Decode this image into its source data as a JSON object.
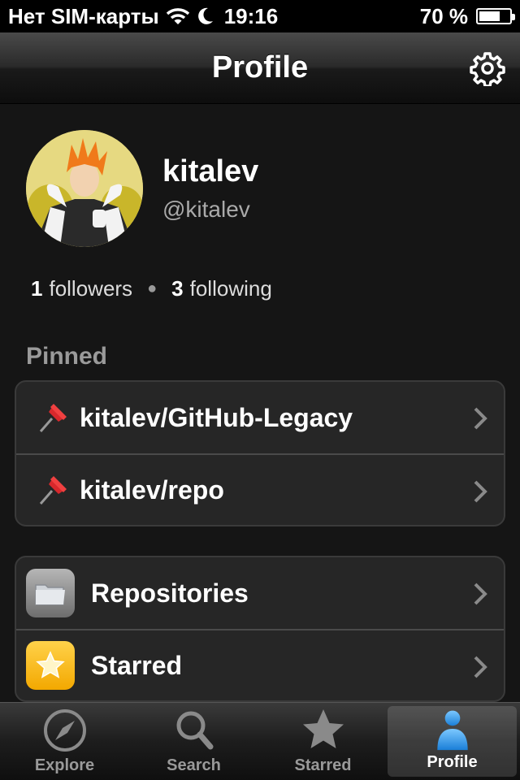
{
  "status_bar": {
    "carrier": "Нет SIM-карты",
    "time": "19:16",
    "battery": "70 %",
    "battery_level": 0.7
  },
  "nav": {
    "title": "Profile",
    "settings_icon": "gear-icon"
  },
  "profile": {
    "name": "kitalev",
    "handle": "@kitalev",
    "followers_count": "1",
    "followers_label": "followers",
    "following_count": "3",
    "following_label": "following",
    "avatar_icon": "avatar"
  },
  "pinned": {
    "label": "Pinned",
    "items": [
      {
        "name": "kitalev/GitHub-Legacy",
        "icon": "pushpin-icon"
      },
      {
        "name": "kitalev/repo",
        "icon": "pushpin-icon"
      }
    ]
  },
  "menu": {
    "items": [
      {
        "label": "Repositories",
        "icon": "folder-icon"
      },
      {
        "label": "Starred",
        "icon": "star-icon"
      }
    ]
  },
  "tabs": [
    {
      "label": "Explore",
      "icon": "compass-icon",
      "active": false
    },
    {
      "label": "Search",
      "icon": "search-icon",
      "active": false
    },
    {
      "label": "Starred",
      "icon": "star-icon",
      "active": false
    },
    {
      "label": "Profile",
      "icon": "person-icon",
      "active": true
    }
  ],
  "colors": {
    "background": "#151515",
    "group_background": "#262626",
    "tile_yellow": "#f3a800",
    "active_tab_icon": "#3aa0ea"
  }
}
